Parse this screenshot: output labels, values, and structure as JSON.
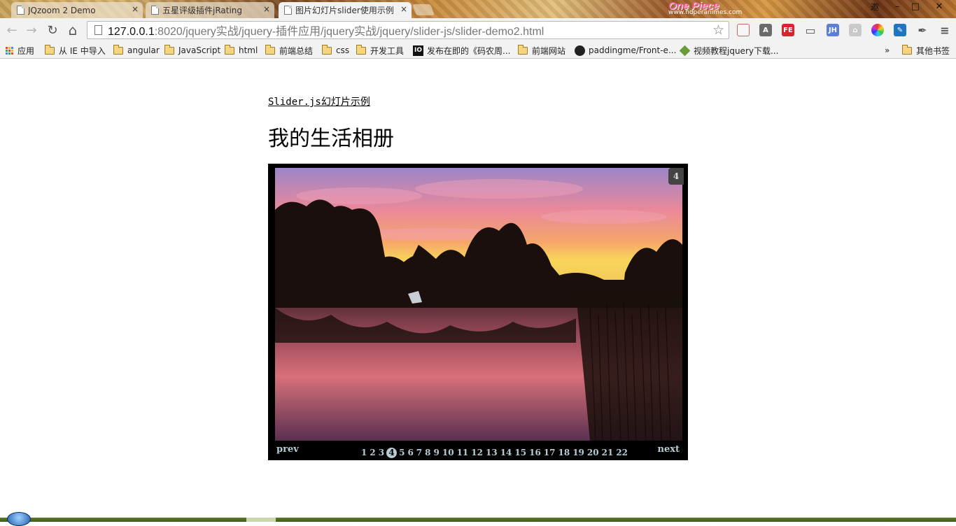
{
  "browser": {
    "tabs": [
      {
        "title": "JQzoom 2 Demo",
        "close": "×",
        "active": false
      },
      {
        "title": "五星评级插件jRating",
        "close": "×",
        "active": false
      },
      {
        "title": "图片幻灯片slider使用示例",
        "close": "×",
        "active": true
      }
    ],
    "brand_text": "One Piece",
    "brand_sub": "www.hdperanimes.com",
    "window_controls": {
      "restore_label": "邀",
      "minimize": "–",
      "maximize": "□",
      "close": "✕"
    },
    "nav": {
      "back": "←",
      "forward": "→",
      "reload": "↻",
      "home": "⌂"
    },
    "url": {
      "host": "127.0.0.1",
      "path": ":8020/jquery实战/jquery-插件应用/jquery实战/jquery/slider-js/slider-demo2.html"
    },
    "star": "☆",
    "extensions": [
      {
        "name": "bookmark-manager-icon",
        "label": "",
        "color": "#f6f6f6"
      },
      {
        "name": "angular-icon",
        "label": "A",
        "color": "#6b6b6b"
      },
      {
        "name": "fe-icon",
        "label": "FE",
        "color": "#d9232d"
      },
      {
        "name": "cast-icon",
        "label": "▭",
        "color": "#555555"
      },
      {
        "name": "jh-icon",
        "label": "JH",
        "color": "#5b7fd6"
      },
      {
        "name": "lock-icon",
        "label": "⌂",
        "color": "#c9c9c9"
      },
      {
        "name": "color-picker-icon",
        "label": "",
        "color": "#2a8e3a"
      },
      {
        "name": "edit-icon",
        "label": "✎",
        "color": "#1f74c4"
      },
      {
        "name": "pen-icon",
        "label": "✒",
        "color": "#555555"
      },
      {
        "name": "menu-icon",
        "label": "≡",
        "color": "#555555"
      }
    ],
    "bookmarks": [
      {
        "label": "应用",
        "type": "apps"
      },
      {
        "label": "从 IE 中导入",
        "type": "folder"
      },
      {
        "label": "angular",
        "type": "folder"
      },
      {
        "label": "JavaScript",
        "type": "folder"
      },
      {
        "label": "html",
        "type": "folder"
      },
      {
        "label": "前端总结",
        "type": "folder"
      },
      {
        "label": "css",
        "type": "folder"
      },
      {
        "label": "开发工具",
        "type": "folder"
      },
      {
        "label": "发布在即的《码农周...",
        "type": "io",
        "badge": "IO"
      },
      {
        "label": "前端网站",
        "type": "folder"
      },
      {
        "label": "paddingme/Front-e...",
        "type": "github"
      },
      {
        "label": "视频教程jquery下载...",
        "type": "video"
      }
    ],
    "bookmarks_overflow": "»",
    "other_bookmarks": "其他书签"
  },
  "page": {
    "link_text": "Slider.js幻灯片示例",
    "heading": "我的生活相册"
  },
  "slider": {
    "counter": "4",
    "prev_label": "prev",
    "next_label": "next",
    "current_page": 4,
    "pages": [
      "1",
      "2",
      "3",
      "4",
      "5",
      "6",
      "7",
      "8",
      "9",
      "10",
      "11",
      "12",
      "13",
      "14",
      "15",
      "16",
      "17",
      "18",
      "19",
      "20",
      "21",
      "22"
    ],
    "photo_colors": {
      "sky_top": "#9b86c9",
      "sky_mid": "#e9889b",
      "horizon": "#f8d65a",
      "water": "#3a2230"
    }
  }
}
